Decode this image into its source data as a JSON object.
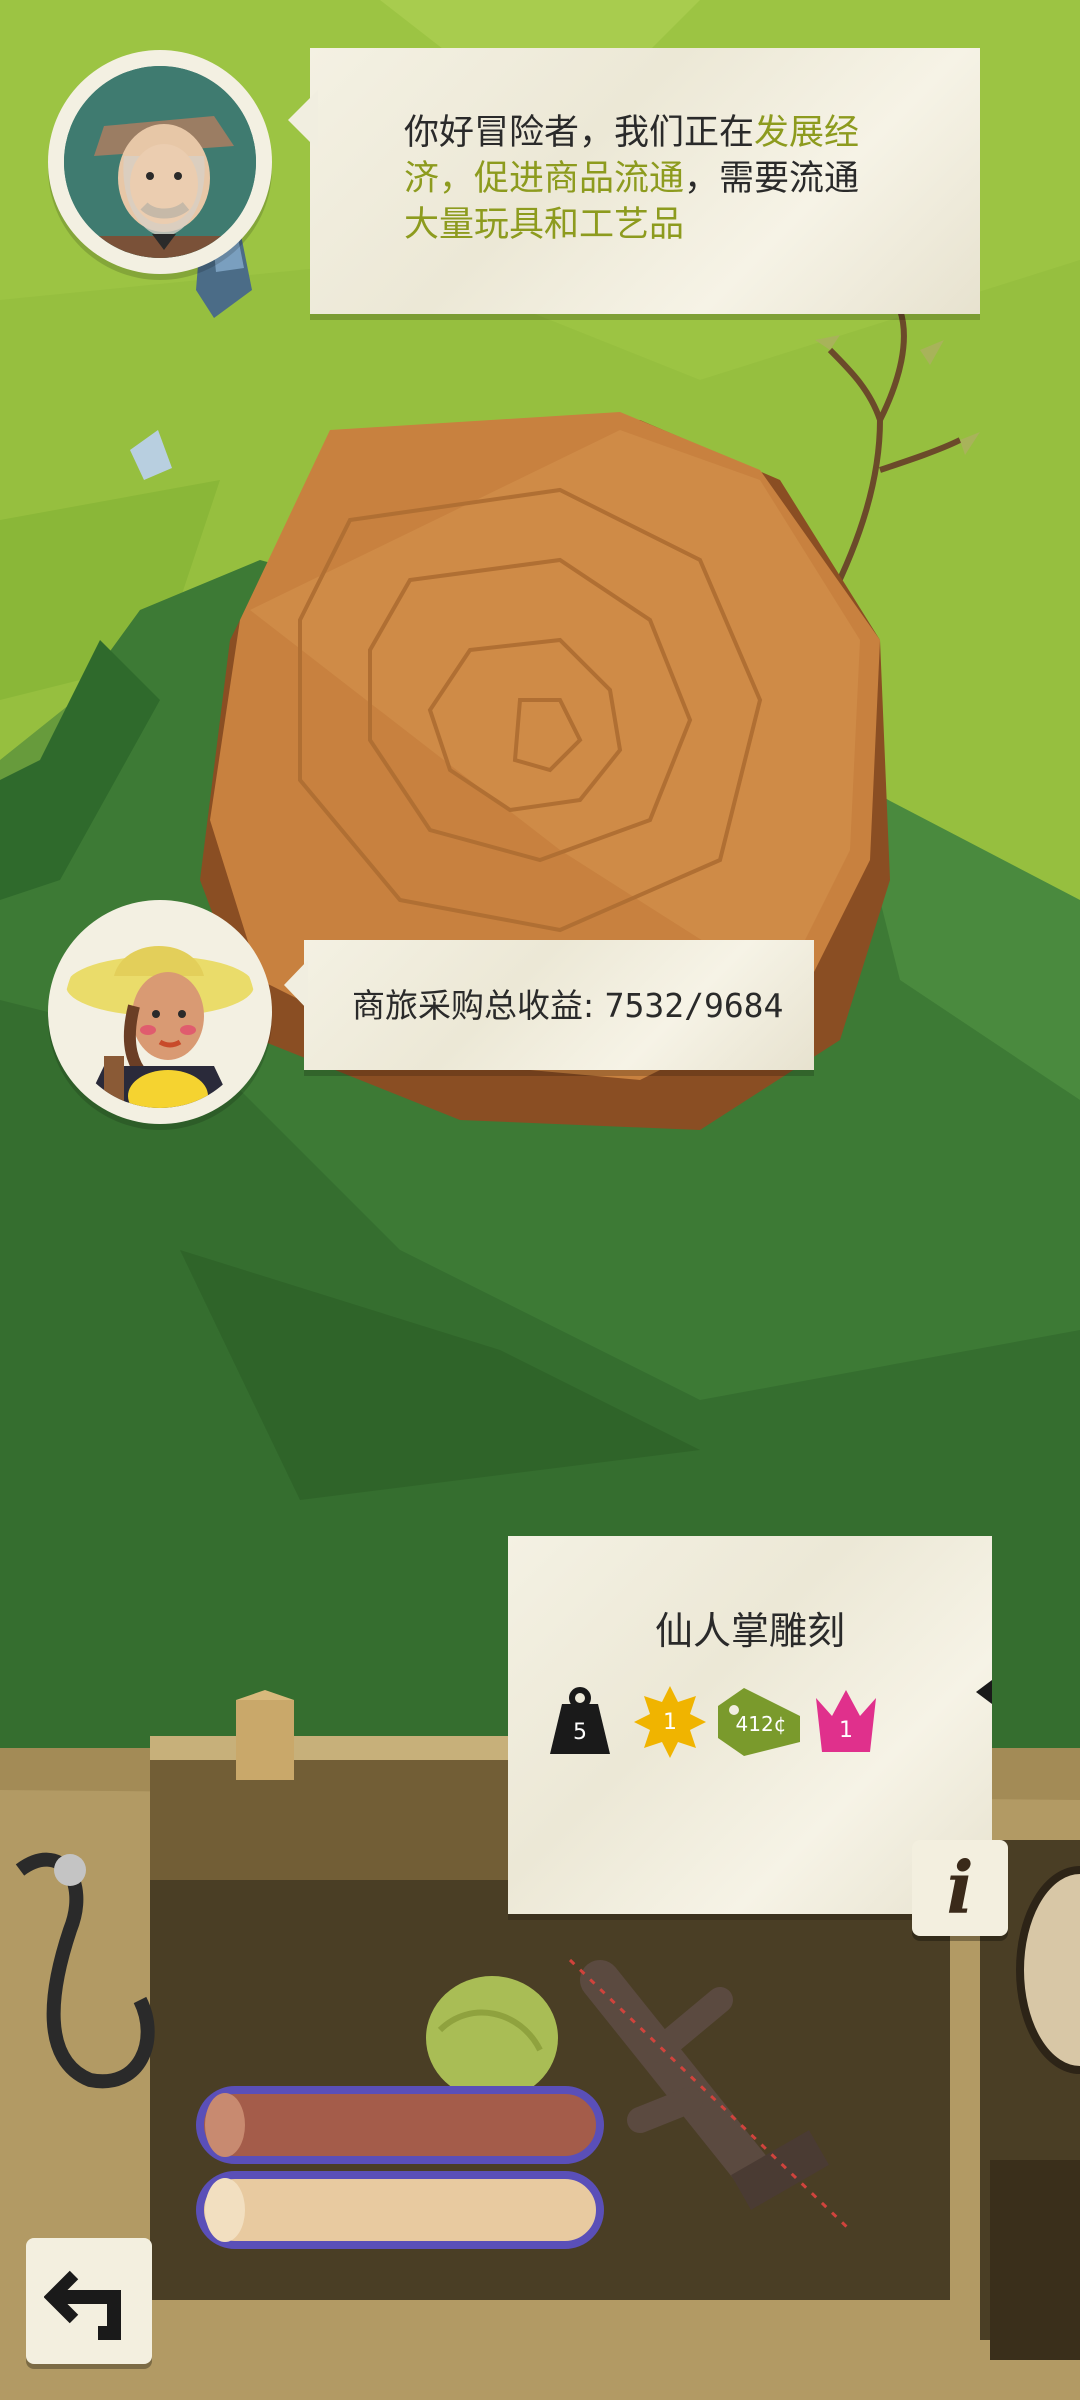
{
  "npc_dialog": {
    "part1": "你好冒险者，我们正在",
    "highlight1": "发展经济，促进商品流通",
    "part2": "，需要流通",
    "highlight2": "大量玩具和工艺品"
  },
  "caravan": {
    "label": "商旅采购总收益: ",
    "progress_text": "7532/9684",
    "current": 7532,
    "target": 9684
  },
  "item_card": {
    "name": "仙人掌雕刻",
    "stats": {
      "weight": "5",
      "rarity": "1",
      "price": "412¢",
      "crown": "1"
    }
  },
  "buttons": {
    "info_glyph": "i",
    "back_icon": "back-arrow-icon"
  },
  "colors": {
    "grass_light": "#9cc443",
    "grass_dark": "#3d7a35",
    "stump": "#c8813f",
    "highlight": "#8d9b1e",
    "rarity": "#f0b400",
    "price_tag": "#7a9a2c",
    "crown": "#e0308c"
  }
}
